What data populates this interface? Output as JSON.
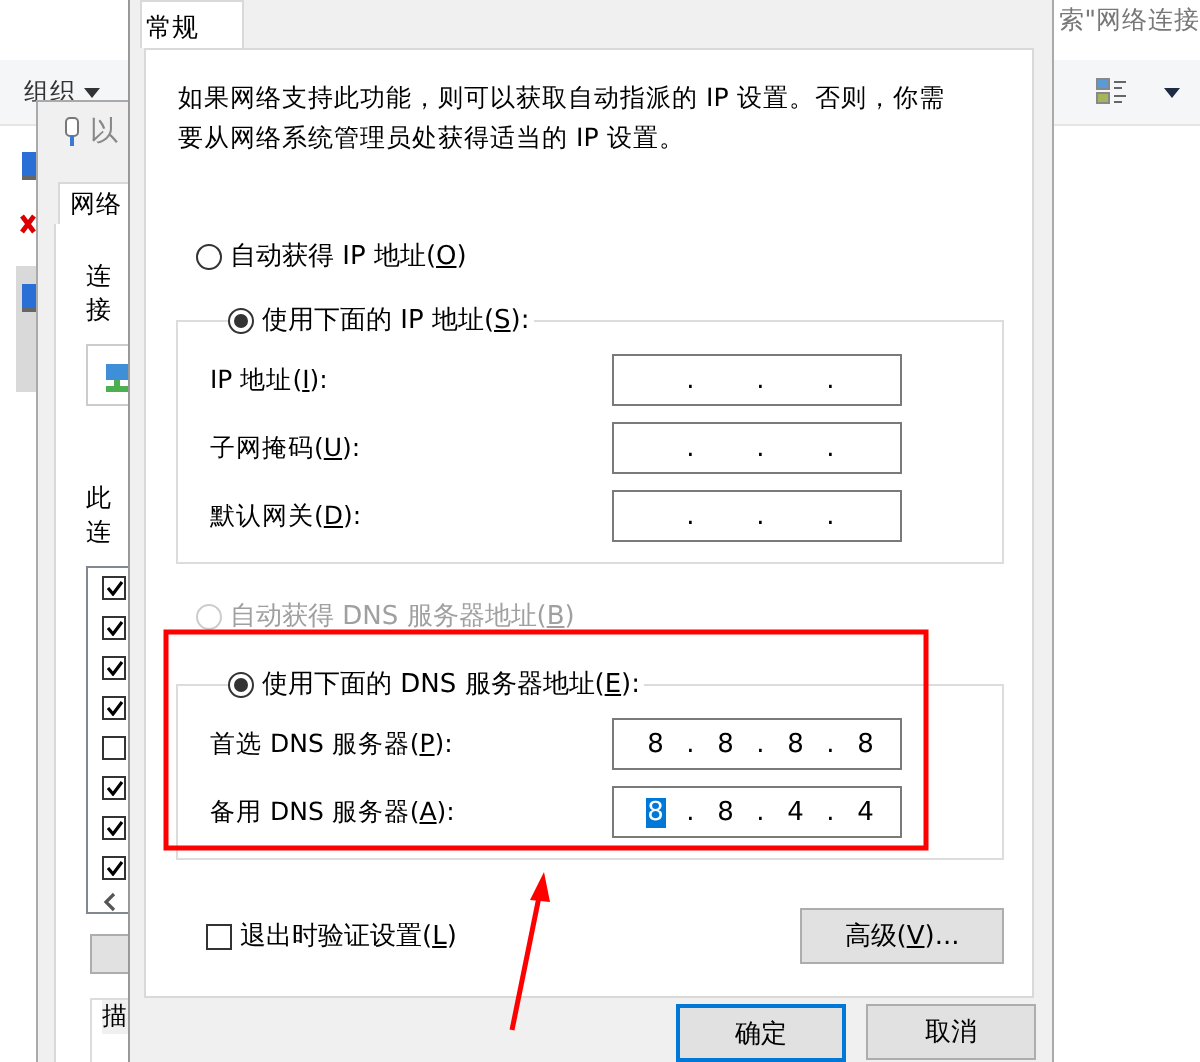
{
  "explorer": {
    "search_text": "索\"网络连接",
    "organize": "组织"
  },
  "adapter_window": {
    "title": "以",
    "tab": "网络",
    "connect_label": "连接",
    "items_label": "此连",
    "description_label": "描",
    "items": [
      {
        "checked": true
      },
      {
        "checked": true
      },
      {
        "checked": true
      },
      {
        "checked": true
      },
      {
        "checked": false
      },
      {
        "checked": true
      },
      {
        "checked": true
      },
      {
        "checked": true
      }
    ]
  },
  "dialog": {
    "tabs": [
      {
        "label": "常规",
        "selected": true
      }
    ],
    "intro": "如果网络支持此功能，则可以获取自动指派的 IP 设置。否则，你需要从网络系统管理员处获得适当的 IP 设置。",
    "sections": [
      {
        "auto": {
          "before": "自动获得 IP 地址(",
          "key": "O",
          "after": ")",
          "selected": false,
          "disabled": false
        },
        "manual": {
          "before": "使用下面的 IP 地址(",
          "key": "S",
          "after": "):",
          "selected": true,
          "disabled": false
        },
        "fields": [
          {
            "before": "IP 地址(",
            "key": "I",
            "after": "):",
            "dots": [
              ".",
              ".",
              "."
            ]
          },
          {
            "before": "子网掩码(",
            "key": "U",
            "after": "):",
            "dots": [
              ".",
              ".",
              "."
            ]
          },
          {
            "before": "默认网关(",
            "key": "D",
            "after": "):",
            "dots": [
              ".",
              ".",
              "."
            ]
          }
        ]
      },
      {
        "auto": {
          "before": "自动获得 DNS 服务器地址(",
          "key": "B",
          "after": ")",
          "selected": false,
          "disabled": true
        },
        "manual": {
          "before": "使用下面的 DNS 服务器地址(",
          "key": "E",
          "after": "):",
          "selected": true,
          "disabled": false
        },
        "fields": [
          {
            "before": "首选 DNS 服务器(",
            "key": "P",
            "after": "):",
            "dots": [
              ".",
              ".",
              "."
            ],
            "octets": [
              {
                "text": "8",
                "selected": false
              },
              {
                "text": "8",
                "selected": false
              },
              {
                "text": "8",
                "selected": false
              },
              {
                "text": "8",
                "selected": false
              }
            ]
          },
          {
            "before": "备用 DNS 服务器(",
            "key": "A",
            "after": "):",
            "dots": [
              ".",
              ".",
              "."
            ],
            "octets": [
              {
                "text": "8",
                "selected": true
              },
              {
                "text": "8",
                "selected": false
              },
              {
                "text": "4",
                "selected": false
              },
              {
                "text": "4",
                "selected": false
              }
            ]
          }
        ]
      }
    ],
    "validate": {
      "before": "退出时验证设置(",
      "key": "L",
      "after": ")",
      "checked": false
    },
    "advanced": {
      "before": "高级(",
      "key": "V",
      "after": ")..."
    },
    "buttons": [
      {
        "label": "确定",
        "default": true
      },
      {
        "label": "取消",
        "default": false
      }
    ]
  }
}
